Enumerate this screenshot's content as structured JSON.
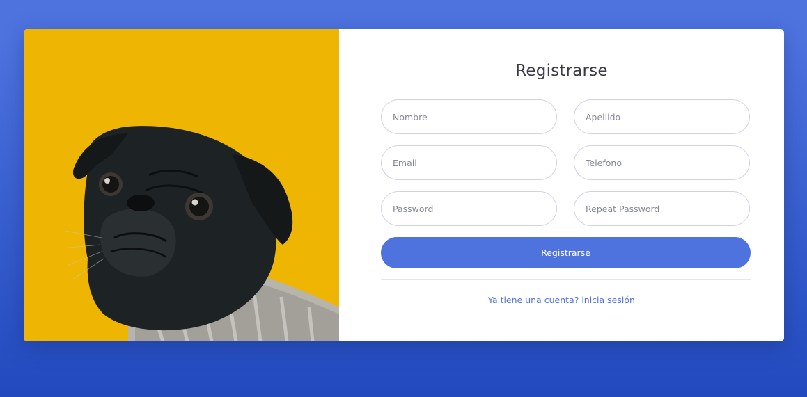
{
  "colors": {
    "background_top": "#4e73df",
    "background_bottom": "#224abe",
    "accent": "#4e73df",
    "image_background": "#efb503"
  },
  "image": {
    "subject": "pug-in-sweater-photo"
  },
  "form": {
    "title": "Registrarse",
    "fields": {
      "first_name": {
        "placeholder": "Nombre",
        "value": ""
      },
      "last_name": {
        "placeholder": "Apellido",
        "value": ""
      },
      "email": {
        "placeholder": "Email",
        "value": ""
      },
      "phone": {
        "placeholder": "Telefono",
        "value": ""
      },
      "password": {
        "placeholder": "Password",
        "value": ""
      },
      "repeat_password": {
        "placeholder": "Repeat Password",
        "value": ""
      }
    },
    "submit_label": "Registrarse",
    "login_link_label": "Ya tiene una cuenta? inicia sesión"
  }
}
